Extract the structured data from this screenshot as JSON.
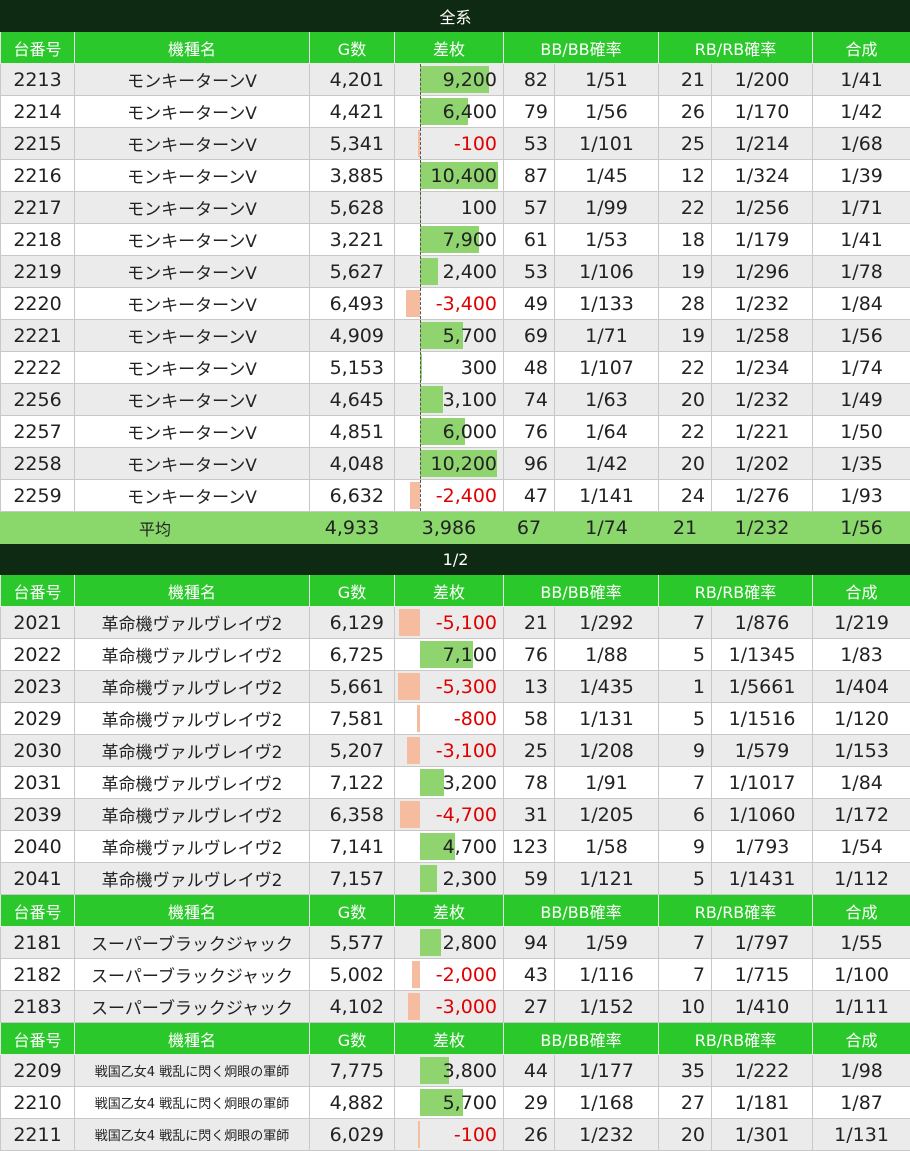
{
  "columns": [
    "台番号",
    "機種名",
    "G数",
    "差枚",
    "BB/BB確率",
    "RB/RB確率",
    "合成"
  ],
  "sections": [
    {
      "title": "全系",
      "groups": [
        {
          "rows": [
            {
              "num": "2213",
              "name": "モンキーターンV",
              "g": "4,201",
              "diff": "9,200",
              "diff_value": 9200,
              "bb": "82",
              "bb_rate": "1/51",
              "rb": "21",
              "rb_rate": "1/200",
              "total": "1/41"
            },
            {
              "num": "2214",
              "name": "モンキーターンV",
              "g": "4,421",
              "diff": "6,400",
              "diff_value": 6400,
              "bb": "79",
              "bb_rate": "1/56",
              "rb": "26",
              "rb_rate": "1/170",
              "total": "1/42"
            },
            {
              "num": "2215",
              "name": "モンキーターンV",
              "g": "5,341",
              "diff": "-100",
              "diff_value": -100,
              "bb": "53",
              "bb_rate": "1/101",
              "rb": "25",
              "rb_rate": "1/214",
              "total": "1/68"
            },
            {
              "num": "2216",
              "name": "モンキーターンV",
              "g": "3,885",
              "diff": "10,400",
              "diff_value": 10400,
              "bb": "87",
              "bb_rate": "1/45",
              "rb": "12",
              "rb_rate": "1/324",
              "total": "1/39"
            },
            {
              "num": "2217",
              "name": "モンキーターンV",
              "g": "5,628",
              "diff": "100",
              "diff_value": 100,
              "bb": "57",
              "bb_rate": "1/99",
              "rb": "22",
              "rb_rate": "1/256",
              "total": "1/71"
            },
            {
              "num": "2218",
              "name": "モンキーターンV",
              "g": "3,221",
              "diff": "7,900",
              "diff_value": 7900,
              "bb": "61",
              "bb_rate": "1/53",
              "rb": "18",
              "rb_rate": "1/179",
              "total": "1/41"
            },
            {
              "num": "2219",
              "name": "モンキーターンV",
              "g": "5,627",
              "diff": "2,400",
              "diff_value": 2400,
              "bb": "53",
              "bb_rate": "1/106",
              "rb": "19",
              "rb_rate": "1/296",
              "total": "1/78"
            },
            {
              "num": "2220",
              "name": "モンキーターンV",
              "g": "6,493",
              "diff": "-3,400",
              "diff_value": -3400,
              "bb": "49",
              "bb_rate": "1/133",
              "rb": "28",
              "rb_rate": "1/232",
              "total": "1/84"
            },
            {
              "num": "2221",
              "name": "モンキーターンV",
              "g": "4,909",
              "diff": "5,700",
              "diff_value": 5700,
              "bb": "69",
              "bb_rate": "1/71",
              "rb": "19",
              "rb_rate": "1/258",
              "total": "1/56"
            },
            {
              "num": "2222",
              "name": "モンキーターンV",
              "g": "5,153",
              "diff": "300",
              "diff_value": 300,
              "bb": "48",
              "bb_rate": "1/107",
              "rb": "22",
              "rb_rate": "1/234",
              "total": "1/74"
            },
            {
              "num": "2256",
              "name": "モンキーターンV",
              "g": "4,645",
              "diff": "3,100",
              "diff_value": 3100,
              "bb": "74",
              "bb_rate": "1/63",
              "rb": "20",
              "rb_rate": "1/232",
              "total": "1/49"
            },
            {
              "num": "2257",
              "name": "モンキーターンV",
              "g": "4,851",
              "diff": "6,000",
              "diff_value": 6000,
              "bb": "76",
              "bb_rate": "1/64",
              "rb": "22",
              "rb_rate": "1/221",
              "total": "1/50"
            },
            {
              "num": "2258",
              "name": "モンキーターンV",
              "g": "4,048",
              "diff": "10,200",
              "diff_value": 10200,
              "bb": "96",
              "bb_rate": "1/42",
              "rb": "20",
              "rb_rate": "1/202",
              "total": "1/35"
            },
            {
              "num": "2259",
              "name": "モンキーターンV",
              "g": "6,632",
              "diff": "-2,400",
              "diff_value": -2400,
              "bb": "47",
              "bb_rate": "1/141",
              "rb": "24",
              "rb_rate": "1/276",
              "total": "1/93"
            }
          ]
        }
      ],
      "average": {
        "label": "平均",
        "g": "4,933",
        "diff": "3,986",
        "bb": "67",
        "bb_rate": "1/74",
        "rb": "21",
        "rb_rate": "1/232",
        "total": "1/56"
      }
    },
    {
      "title": "1/2",
      "groups": [
        {
          "rows": [
            {
              "num": "2021",
              "name": "革命機ヴァルヴレイヴ2",
              "g": "6,129",
              "diff": "-5,100",
              "diff_value": -5100,
              "bb": "21",
              "bb_rate": "1/292",
              "rb": "7",
              "rb_rate": "1/876",
              "total": "1/219"
            },
            {
              "num": "2022",
              "name": "革命機ヴァルヴレイヴ2",
              "g": "6,725",
              "diff": "7,100",
              "diff_value": 7100,
              "bb": "76",
              "bb_rate": "1/88",
              "rb": "5",
              "rb_rate": "1/1345",
              "total": "1/83"
            },
            {
              "num": "2023",
              "name": "革命機ヴァルヴレイヴ2",
              "g": "5,661",
              "diff": "-5,300",
              "diff_value": -5300,
              "bb": "13",
              "bb_rate": "1/435",
              "rb": "1",
              "rb_rate": "1/5661",
              "total": "1/404"
            },
            {
              "num": "2029",
              "name": "革命機ヴァルヴレイヴ2",
              "g": "7,581",
              "diff": "-800",
              "diff_value": -800,
              "bb": "58",
              "bb_rate": "1/131",
              "rb": "5",
              "rb_rate": "1/1516",
              "total": "1/120"
            },
            {
              "num": "2030",
              "name": "革命機ヴァルヴレイヴ2",
              "g": "5,207",
              "diff": "-3,100",
              "diff_value": -3100,
              "bb": "25",
              "bb_rate": "1/208",
              "rb": "9",
              "rb_rate": "1/579",
              "total": "1/153"
            },
            {
              "num": "2031",
              "name": "革命機ヴァルヴレイヴ2",
              "g": "7,122",
              "diff": "3,200",
              "diff_value": 3200,
              "bb": "78",
              "bb_rate": "1/91",
              "rb": "7",
              "rb_rate": "1/1017",
              "total": "1/84"
            },
            {
              "num": "2039",
              "name": "革命機ヴァルヴレイヴ2",
              "g": "6,358",
              "diff": "-4,700",
              "diff_value": -4700,
              "bb": "31",
              "bb_rate": "1/205",
              "rb": "6",
              "rb_rate": "1/1060",
              "total": "1/172"
            },
            {
              "num": "2040",
              "name": "革命機ヴァルヴレイヴ2",
              "g": "7,141",
              "diff": "4,700",
              "diff_value": 4700,
              "bb": "123",
              "bb_rate": "1/58",
              "rb": "9",
              "rb_rate": "1/793",
              "total": "1/54"
            },
            {
              "num": "2041",
              "name": "革命機ヴァルヴレイヴ2",
              "g": "7,157",
              "diff": "2,300",
              "diff_value": 2300,
              "bb": "59",
              "bb_rate": "1/121",
              "rb": "5",
              "rb_rate": "1/1431",
              "total": "1/112"
            }
          ]
        },
        {
          "rows": [
            {
              "num": "2181",
              "name": "スーパーブラックジャック",
              "g": "5,577",
              "diff": "2,800",
              "diff_value": 2800,
              "bb": "94",
              "bb_rate": "1/59",
              "rb": "7",
              "rb_rate": "1/797",
              "total": "1/55"
            },
            {
              "num": "2182",
              "name": "スーパーブラックジャック",
              "g": "5,002",
              "diff": "-2,000",
              "diff_value": -2000,
              "bb": "43",
              "bb_rate": "1/116",
              "rb": "7",
              "rb_rate": "1/715",
              "total": "1/100"
            },
            {
              "num": "2183",
              "name": "スーパーブラックジャック",
              "g": "4,102",
              "diff": "-3,000",
              "diff_value": -3000,
              "bb": "27",
              "bb_rate": "1/152",
              "rb": "10",
              "rb_rate": "1/410",
              "total": "1/111"
            }
          ]
        },
        {
          "small": true,
          "rows": [
            {
              "num": "2209",
              "name": "戦国乙女4 戦乱に閃く炯眼の軍師",
              "g": "7,775",
              "diff": "3,800",
              "diff_value": 3800,
              "bb": "44",
              "bb_rate": "1/177",
              "rb": "35",
              "rb_rate": "1/222",
              "total": "1/98"
            },
            {
              "num": "2210",
              "name": "戦国乙女4 戦乱に閃く炯眼の軍師",
              "g": "4,882",
              "diff": "5,700",
              "diff_value": 5700,
              "bb": "29",
              "bb_rate": "1/168",
              "rb": "27",
              "rb_rate": "1/181",
              "total": "1/87"
            },
            {
              "num": "2211",
              "name": "戦国乙女4 戦乱に閃く炯眼の軍師",
              "g": "6,029",
              "diff": "-100",
              "diff_value": -100,
              "bb": "26",
              "bb_rate": "1/232",
              "rb": "20",
              "rb_rate": "1/301",
              "total": "1/131"
            }
          ]
        }
      ]
    }
  ],
  "colors": {
    "header": "#2bc82b",
    "title": "#0e2a12",
    "average": "#8ad86c",
    "positive_bar": "#8fd46e",
    "negative_bar": "#f5bca0",
    "negative_text": "#e00000"
  }
}
